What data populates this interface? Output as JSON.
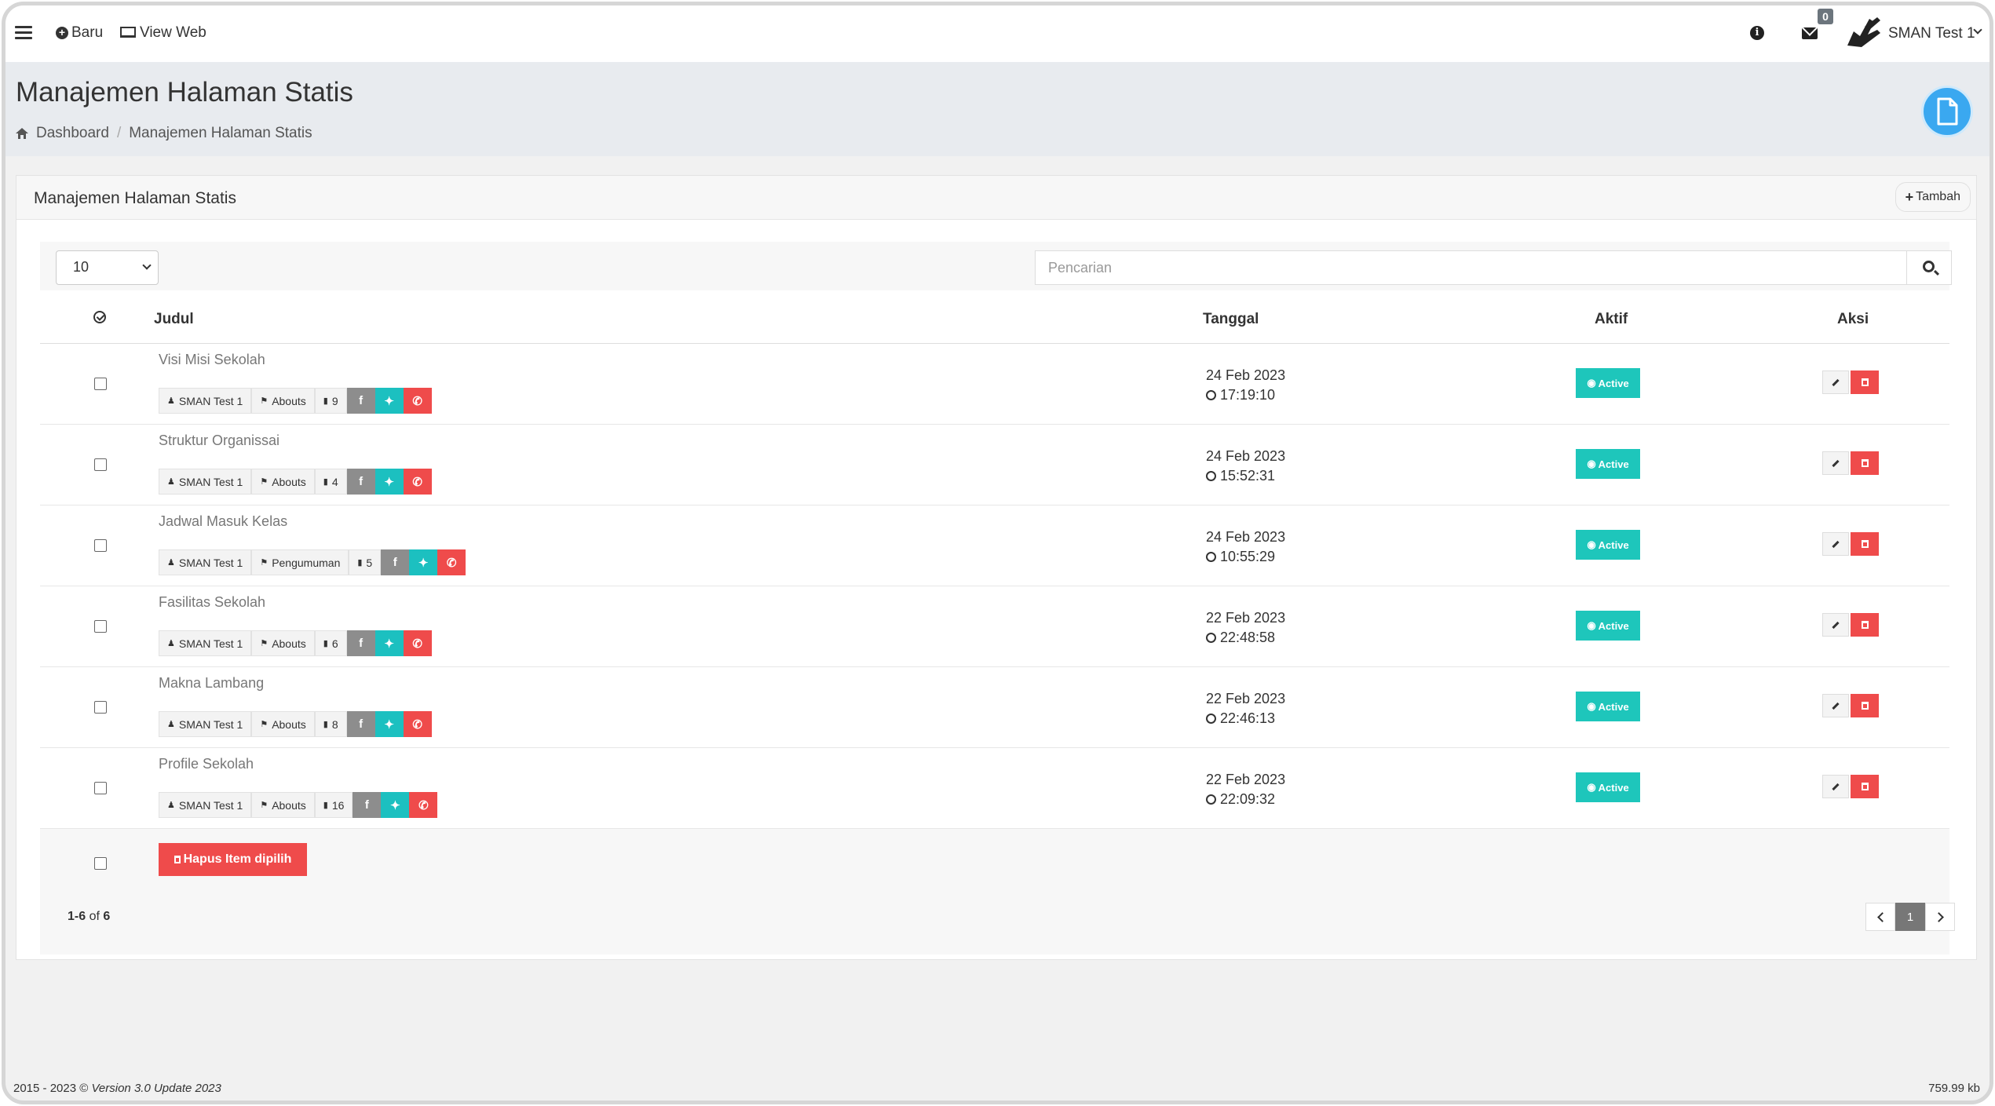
{
  "nav": {
    "new_label": "Baru",
    "view_web_label": "View Web",
    "mail_count": "0",
    "user_name": "SMAN Test 1"
  },
  "header": {
    "title": "Manajemen Halaman Statis",
    "breadcrumb": [
      "Dashboard",
      "Manajemen Halaman Statis"
    ]
  },
  "panel": {
    "title": "Manajemen Halaman Statis",
    "add_label": "Tambah",
    "page_size": "10",
    "search_placeholder": "Pencarian"
  },
  "table": {
    "columns": [
      "Judul",
      "Tanggal",
      "Aktif",
      "Aksi"
    ],
    "rows": [
      {
        "title": "Visi Misi Sekolah",
        "author": "SMAN Test 1",
        "category": "Abouts",
        "views": "9",
        "date": "24 Feb 2023",
        "time": "17:19:10",
        "status": "Active"
      },
      {
        "title": "Struktur Organissai",
        "author": "SMAN Test 1",
        "category": "Abouts",
        "views": "4",
        "date": "24 Feb 2023",
        "time": "15:52:31",
        "status": "Active"
      },
      {
        "title": "Jadwal Masuk Kelas",
        "author": "SMAN Test 1",
        "category": "Pengumuman",
        "views": "5",
        "date": "24 Feb 2023",
        "time": "10:55:29",
        "status": "Active"
      },
      {
        "title": "Fasilitas Sekolah",
        "author": "SMAN Test 1",
        "category": "Abouts",
        "views": "6",
        "date": "22 Feb 2023",
        "time": "22:48:58",
        "status": "Active"
      },
      {
        "title": "Makna Lambang",
        "author": "SMAN Test 1",
        "category": "Abouts",
        "views": "8",
        "date": "22 Feb 2023",
        "time": "22:46:13",
        "status": "Active"
      },
      {
        "title": "Profile Sekolah",
        "author": "SMAN Test 1",
        "category": "Abouts",
        "views": "16",
        "date": "22 Feb 2023",
        "time": "22:09:32",
        "status": "Active"
      }
    ],
    "bulk_delete_label": "Hapus Item dipilih",
    "range_from_to": "1-6",
    "range_of": "of",
    "range_total": "6",
    "current_page": "1"
  },
  "footer": {
    "years": "2015 - 2023 ©",
    "version": "Version 3.0 Update 2023",
    "memory": "759.99 kb"
  },
  "colors": {
    "accent_teal": "#1ec6bb",
    "danger_red": "#ef4b4b",
    "fab_blue": "#3aa8f0"
  }
}
